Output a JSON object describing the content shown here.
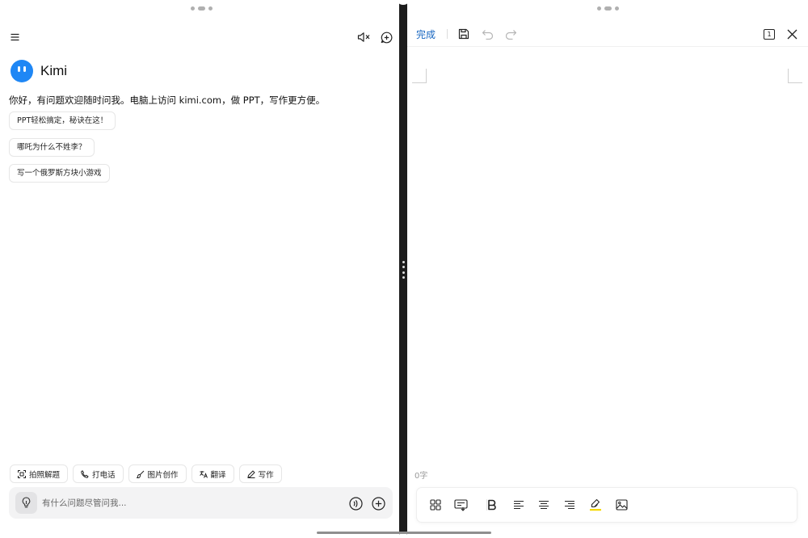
{
  "left": {
    "assistant_name": "Kimi",
    "greeting": "你好，有问题欢迎随时问我。电脑上访问 kimi.com，做 PPT，写作更方便。",
    "suggestions": [
      {
        "label": "PPT轻松搞定，秘诀在这！"
      },
      {
        "label": "哪吒为什么不姓李？"
      },
      {
        "label": "写一个俄罗斯方块小游戏"
      }
    ],
    "tools": [
      {
        "label": "拍照解题",
        "icon": "scan-icon"
      },
      {
        "label": "打电话",
        "icon": "phone-icon"
      },
      {
        "label": "图片创作",
        "icon": "brush-icon"
      },
      {
        "label": "翻译",
        "icon": "translate-icon"
      },
      {
        "label": "写作",
        "icon": "pen-icon"
      }
    ],
    "input": {
      "placeholder": "有什么问题尽管问我..."
    }
  },
  "right": {
    "done_label": "完成",
    "page_indicator": "1",
    "word_count": "0字"
  },
  "colors": {
    "accent": "#1565c0",
    "kimi_logo": "#1f87f5",
    "highlight": "#f5d800"
  }
}
